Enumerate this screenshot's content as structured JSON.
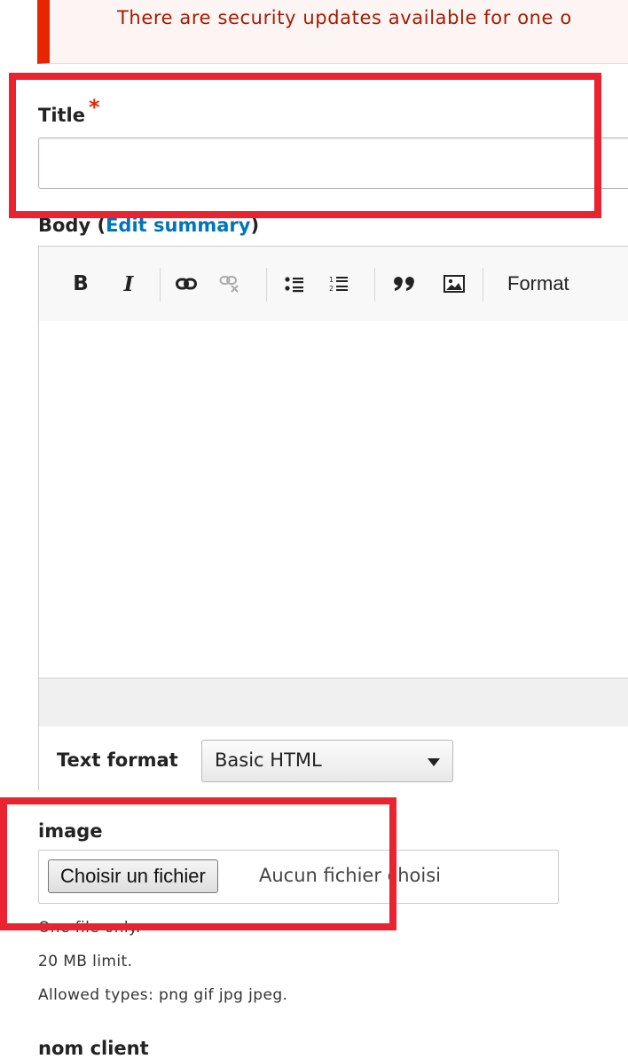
{
  "messages": {
    "warning_text": "There are security updates available for one o"
  },
  "form": {
    "title_label": "Title",
    "title_required_marker": "*",
    "title_value": "",
    "body_label_prefix": "Body (",
    "body_edit_summary_link": "Edit summary",
    "body_label_suffix": ")",
    "toolbar": {
      "bold": "B",
      "italic": "I",
      "format_label": "Format",
      "icons": [
        "bold-icon",
        "italic-icon",
        "link-icon",
        "unlink-icon",
        "bulleted-list-icon",
        "numbered-list-icon",
        "blockquote-icon",
        "image-icon"
      ]
    },
    "text_format_label": "Text format",
    "text_format_selected": "Basic HTML",
    "image_label": "image",
    "file_button_label": "Choisir un fichier",
    "file_status": "Aucun fichier choisi",
    "file_descriptions": [
      "One file only.",
      "20 MB limit.",
      "Allowed types: png gif jpg jpeg."
    ],
    "next_field_label": "nom client"
  },
  "colors": {
    "highlight": "#ea2330",
    "link": "#0074bd",
    "error_accent": "#e62600"
  }
}
